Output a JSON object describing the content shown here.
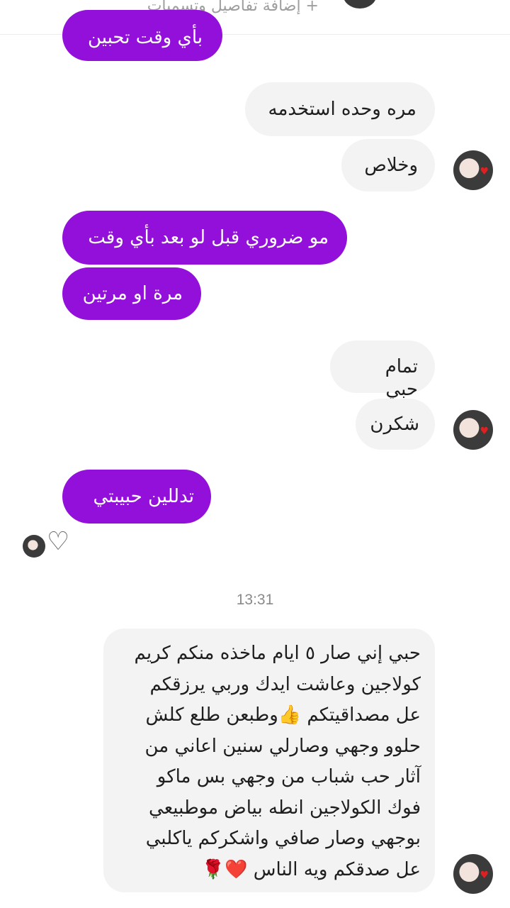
{
  "header": {
    "hint": "+ إضافة تفاصيل وتسميات"
  },
  "messages": [
    {
      "id": "m0",
      "side": "out",
      "text": "بأي وقت تحبين"
    },
    {
      "id": "m1",
      "side": "in",
      "text": "مره وحده استخدمه"
    },
    {
      "id": "m2",
      "side": "in",
      "text": "وخلاص"
    },
    {
      "id": "m3",
      "side": "out",
      "text": "مو ضروري قبل لو بعد بأي وقت"
    },
    {
      "id": "m4",
      "side": "out",
      "text": "مرة او مرتين"
    },
    {
      "id": "m5",
      "side": "in",
      "text": "تمام حبي"
    },
    {
      "id": "m6",
      "side": "in",
      "text": "شكرن"
    },
    {
      "id": "m7",
      "side": "out",
      "text": "تدللين حبيبتي"
    },
    {
      "id": "m8",
      "side": "in",
      "lines": [
        "حبي إني صار ٥ ايام ماخذه منكم كريم",
        "كولاجين وعاشت ايدك وربي يرزقكم",
        "عل مصداقيتكم 👍وطبعن طلع كلش",
        "حلوو وجهي وصارلي سنين اعاني من",
        "آثار حب شباب من وجهي بس ماكو",
        "فوك الكولاجين انطه بياض موطبيعي",
        "بوجهي وصار صافي واشكركم ياكلبي",
        "عل صدقكم ويه الناس ❤️🌹"
      ]
    }
  ],
  "timestamp": "13:31",
  "colors": {
    "outgoing_bubble": "#9210d9",
    "incoming_bubble": "#f3f3f3",
    "background": "#ffffff"
  },
  "icons": {
    "reaction": "heart-outline-icon",
    "avatar_badge": "heart-icon"
  }
}
